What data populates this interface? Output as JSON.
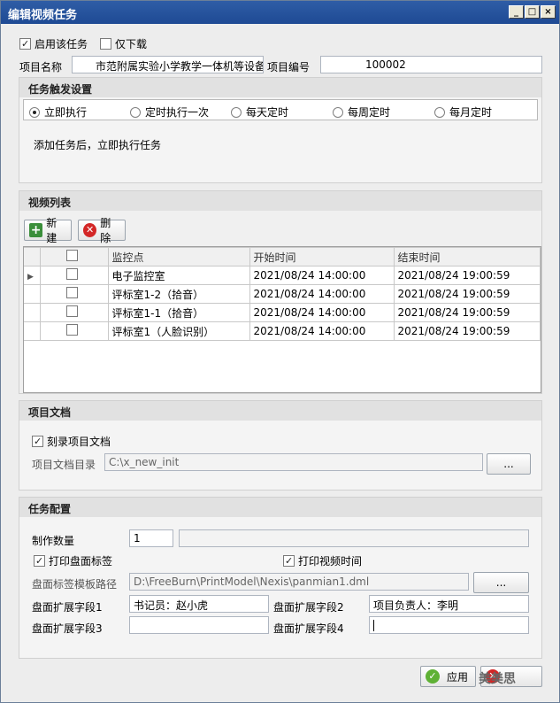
{
  "window": {
    "title": "编辑视频任务"
  },
  "top": {
    "enable_task_label": "启用该任务",
    "enable_task_checked": true,
    "download_only_label": "仅下载",
    "download_only_checked": false,
    "project_name_label": "项目名称",
    "project_name_value": "市范附属实验小学教学一体机等设备",
    "project_no_label": "项目编号",
    "project_no_value": "100002"
  },
  "trigger": {
    "header": "任务触发设置",
    "options": [
      "立即执行",
      "定时执行一次",
      "每天定时",
      "每周定时",
      "每月定时"
    ],
    "selected": "立即执行",
    "description": "添加任务后，立即执行任务"
  },
  "video_list": {
    "header": "视频列表",
    "new_label": "新建",
    "delete_label": "删除",
    "columns": [
      "监控点",
      "开始时间",
      "结束时间"
    ],
    "rows": [
      {
        "point": "电子监控室",
        "start": "2021/08/24 14:00:00",
        "end": "2021/08/24 19:00:59"
      },
      {
        "point": "评标室1-2（拾音）",
        "start": "2021/08/24 14:00:00",
        "end": "2021/08/24 19:00:59"
      },
      {
        "point": "评标室1-1（拾音）",
        "start": "2021/08/24 14:00:00",
        "end": "2021/08/24 19:00:59"
      },
      {
        "point": "评标室1（人脸识别）",
        "start": "2021/08/24 14:00:00",
        "end": "2021/08/24 19:00:59"
      }
    ]
  },
  "docs": {
    "header": "项目文档",
    "burn_docs_label": "刻录项目文档",
    "burn_docs_checked": true,
    "dir_label": "项目文档目录",
    "dir_value": "C:\\x_new_init",
    "browse_label": "..."
  },
  "config": {
    "header": "任务配置",
    "count_label": "制作数量",
    "count_value": "1",
    "print_label_label": "打印盘面标签",
    "print_label_checked": true,
    "print_time_label": "打印视频时间",
    "print_time_checked": true,
    "template_label": "盘面标签模板路径",
    "template_value": "D:\\FreeBurn\\PrintModel\\Nexis\\panmian1.dml",
    "browse_label": "...",
    "ext1_label": "盘面扩展字段1",
    "ext1_value": "书记员：赵小虎",
    "ext2_label": "盘面扩展字段2",
    "ext2_value": "项目负责人：李明",
    "ext3_label": "盘面扩展字段3",
    "ext3_value": "",
    "ext4_label": "盘面扩展字段4",
    "ext4_value": ""
  },
  "footer": {
    "apply_label": "应用",
    "watermark": "美美思"
  }
}
